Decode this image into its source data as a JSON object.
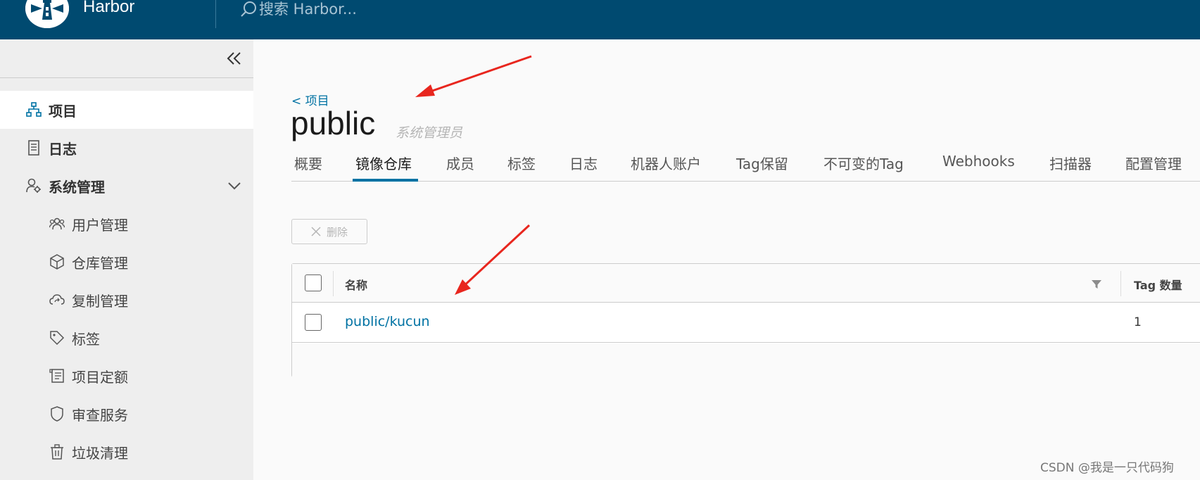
{
  "header": {
    "brand": "Harbor",
    "search_placeholder": "搜索 Harbor..."
  },
  "sidebar": {
    "items": [
      {
        "label": "项目",
        "icon": "project-icon",
        "active": true
      },
      {
        "label": "日志",
        "icon": "log-icon"
      },
      {
        "label": "系统管理",
        "icon": "admin-icon",
        "expandable": true
      }
    ],
    "sub_items": [
      {
        "label": "用户管理",
        "icon": "users-icon"
      },
      {
        "label": "仓库管理",
        "icon": "cube-icon"
      },
      {
        "label": "复制管理",
        "icon": "cloud-sync-icon"
      },
      {
        "label": "标签",
        "icon": "tag-icon"
      },
      {
        "label": "项目定额",
        "icon": "quota-icon"
      },
      {
        "label": "审查服务",
        "icon": "shield-icon"
      },
      {
        "label": "垃圾清理",
        "icon": "trash-icon"
      }
    ]
  },
  "main": {
    "back_link": "< 项目",
    "title": "public",
    "role": "系统管理员",
    "tabs": [
      {
        "label": "概要"
      },
      {
        "label": "镜像仓库",
        "active": true
      },
      {
        "label": "成员"
      },
      {
        "label": "标签"
      },
      {
        "label": "日志"
      },
      {
        "label": "机器人账户"
      },
      {
        "label": "Tag保留"
      },
      {
        "label": "不可变的Tag"
      },
      {
        "label": "Webhooks"
      },
      {
        "label": "扫描器"
      },
      {
        "label": "配置管理"
      }
    ],
    "delete_label": "删除",
    "grid": {
      "columns": [
        "名称",
        "Tag 数量"
      ],
      "rows": [
        {
          "name": "public/kucun",
          "tag_count": "1"
        }
      ]
    }
  },
  "watermark": "CSDN @我是一只代码狗",
  "colors": {
    "header": "#004a70",
    "link": "#0072a3",
    "arrow": "#e8261e"
  }
}
